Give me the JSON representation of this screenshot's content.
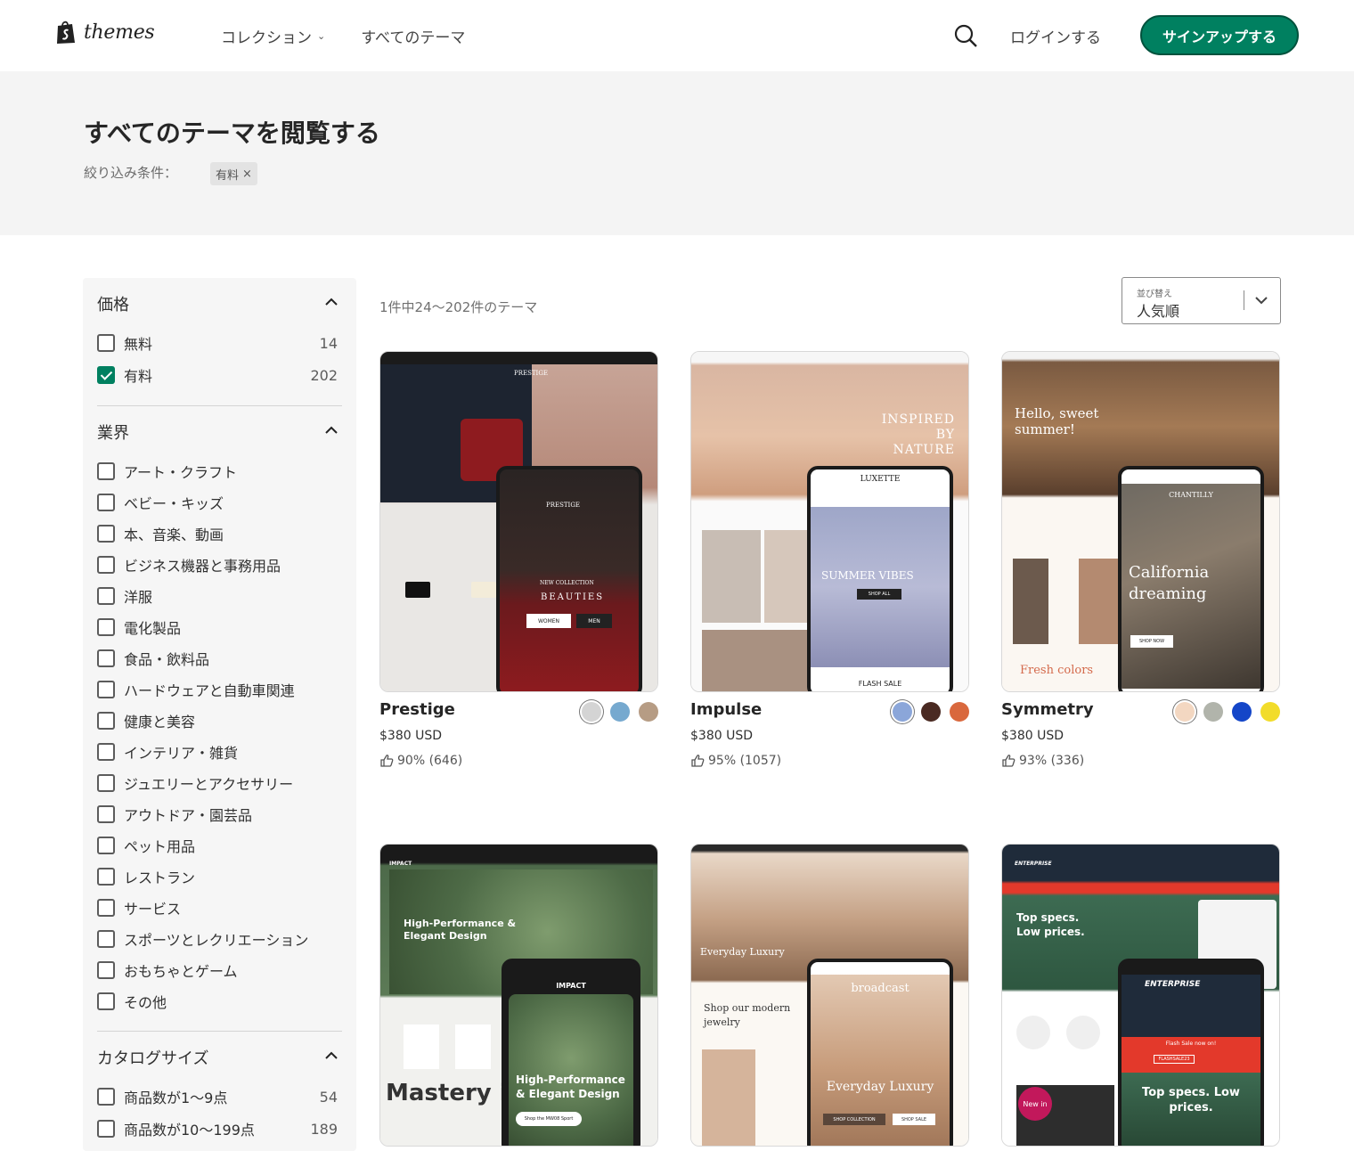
{
  "header": {
    "logo_text": "themes",
    "nav": [
      {
        "label": "コレクション",
        "has_dropdown": true
      },
      {
        "label": "すべてのテーマ",
        "has_dropdown": false
      }
    ],
    "login_label": "ログインする",
    "signup_label": "サインアップする"
  },
  "hero": {
    "title": "すべてのテーマを閲覧する",
    "filter_label": "絞り込み条件：",
    "active_filter": "有料"
  },
  "sidebar": {
    "price": {
      "title": "価格",
      "options": [
        {
          "label": "無料",
          "count": "14",
          "checked": false
        },
        {
          "label": "有料",
          "count": "202",
          "checked": true
        }
      ]
    },
    "industry": {
      "title": "業界",
      "options": [
        {
          "label": "アート・クラフト"
        },
        {
          "label": "ベビー・キッズ"
        },
        {
          "label": "本、音楽、動画"
        },
        {
          "label": "ビジネス機器と事務用品"
        },
        {
          "label": "洋服"
        },
        {
          "label": "電化製品"
        },
        {
          "label": "食品・飲料品"
        },
        {
          "label": "ハードウェアと自動車関連"
        },
        {
          "label": "健康と美容"
        },
        {
          "label": "インテリア・雑貨"
        },
        {
          "label": "ジュエリーとアクセサリー"
        },
        {
          "label": "アウトドア・園芸品"
        },
        {
          "label": "ペット用品"
        },
        {
          "label": "レストラン"
        },
        {
          "label": "サービス"
        },
        {
          "label": "スポーツとレクリエーション"
        },
        {
          "label": "おもちゃとゲーム"
        },
        {
          "label": "その他"
        }
      ]
    },
    "catalog": {
      "title": "カタログサイズ",
      "options": [
        {
          "label": "商品数が1〜9点",
          "count": "54"
        },
        {
          "label": "商品数が10〜199点",
          "count": "189"
        }
      ]
    }
  },
  "main": {
    "result_count": "1件中24〜202件のテーマ",
    "sort_label": "並び替え",
    "sort_value": "人気順"
  },
  "themes": [
    {
      "name": "Prestige",
      "price": "$380 USD",
      "rating": "90% (646)",
      "swatches": [
        "#d4d4d4",
        "#76a9cf",
        "#b69c84"
      ],
      "mock_brand": "PRESTIGE",
      "mock_headline": "BEAUTIES",
      "mock_sub": "NEW COLLECTION",
      "mock_btn1": "WOMEN",
      "mock_btn2": "MEN"
    },
    {
      "name": "Impulse",
      "price": "$380 USD",
      "rating": "95% (1057)",
      "swatches": [
        "#8ba6d9",
        "#4a2a22",
        "#d9683d"
      ],
      "mock_brand": "LUXETTE",
      "mock_headline": "INSPIRED BY NATURE",
      "mock_sub": "SUMMER VIBES",
      "mock_btn1": "SHOP ALL",
      "mock_btn2": "FLASH SALE"
    },
    {
      "name": "Symmetry",
      "price": "$380 USD",
      "rating": "93% (336)",
      "swatches": [
        "#f3d7c1",
        "#b1b4ab",
        "#1446c8",
        "#f2dc2a"
      ],
      "mock_brand": "CHANTILLY",
      "mock_headline": "California dreaming",
      "mock_sub": "Hello, sweet summer!",
      "mock_btn1": "SHOP NOW",
      "mock_btn2": "Fresh colors"
    },
    {
      "name": "",
      "mock_brand": "IMPACT",
      "mock_headline": "High-Performance & Elegant Design",
      "mock_sub": "Mastery is",
      "mock_btn1": "Shop the MW08 Sport"
    },
    {
      "name": "",
      "mock_brand": "broadcast",
      "mock_headline": "Everyday Luxury",
      "mock_sub": "Shop our modern jewelry",
      "mock_btn1": "SHOP COLLECTION",
      "mock_btn2": "SHOP SALE"
    },
    {
      "name": "",
      "mock_brand": "ENTERPRISE",
      "mock_headline": "Top specs. Low prices.",
      "mock_sub": "Flash Sale now on!",
      "mock_btn1": "FLASHSALE23",
      "mock_btn2": "New in"
    }
  ],
  "colors": {
    "accent": "#008060",
    "band": "#f4f4f4",
    "sidebar": "#f6f6f6"
  }
}
